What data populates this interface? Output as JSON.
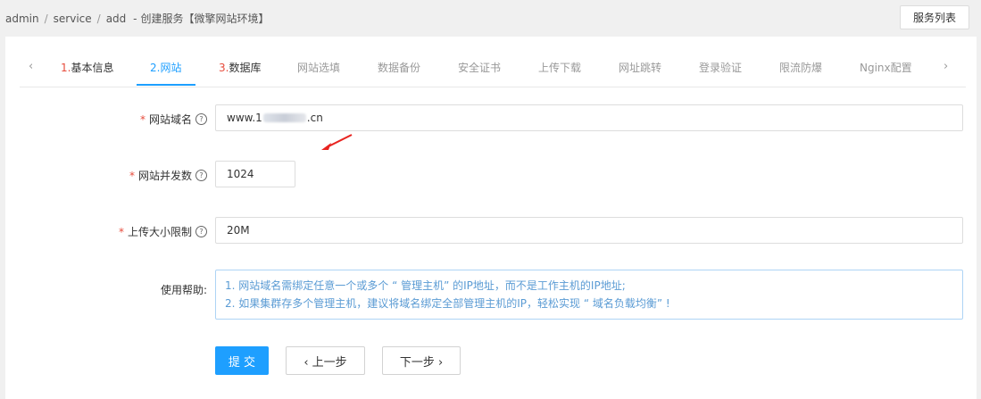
{
  "breadcrumb": {
    "items": [
      "admin",
      "service",
      "add"
    ],
    "separator": "/",
    "title_prefix": "-",
    "title": "创建服务【微擎网站环境】"
  },
  "header": {
    "list_button": "服务列表"
  },
  "tabs": {
    "prev_arrow": "‹",
    "next_arrow": "›",
    "items": [
      {
        "num": "1.",
        "label": "基本信息"
      },
      {
        "num": "2.",
        "label": "网站"
      },
      {
        "num": "3.",
        "label": "数据库"
      },
      {
        "label": "网站选填"
      },
      {
        "label": "数据备份"
      },
      {
        "label": "安全证书"
      },
      {
        "label": "上传下载"
      },
      {
        "label": "网址跳转"
      },
      {
        "label": "登录验证"
      },
      {
        "label": "限流防爆"
      },
      {
        "label": "Nginx配置"
      }
    ]
  },
  "form": {
    "required_mark": "*",
    "help_glyph": "?",
    "domain": {
      "label": "网站域名",
      "value_start": "www.1",
      "value_end": ".cn"
    },
    "concurrency": {
      "label": "网站并发数",
      "value": "1024"
    },
    "upload_limit": {
      "label": "上传大小限制",
      "value": "20M"
    },
    "help": {
      "label": "使用帮助:",
      "lines": [
        "1. 网站域名需绑定任意一个或多个 “ 管理主机” 的IP地址，而不是工作主机的IP地址;",
        "2. 如果集群存多个管理主机，建议将域名绑定全部管理主机的IP，轻松实现 “ 域名负载均衡” !"
      ]
    }
  },
  "buttons": {
    "submit": "提 交",
    "prev": "‹  上一步",
    "next": "下一步  ›"
  },
  "colors": {
    "accent": "#1e9fff",
    "required": "#e74c3c",
    "annotation_arrow": "#e8231f"
  }
}
